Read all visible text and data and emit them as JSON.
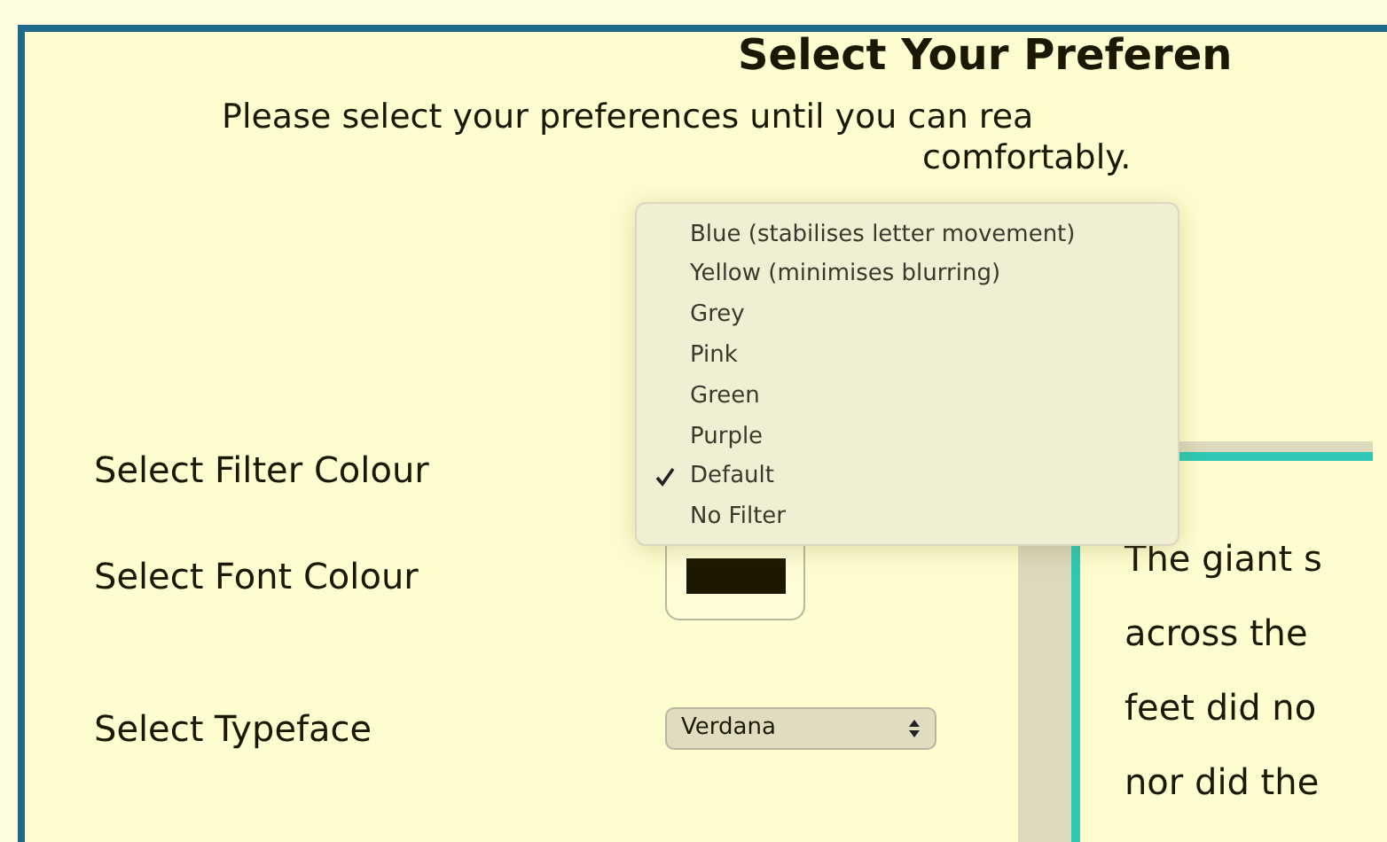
{
  "title": "Select Your Preferen",
  "intro": [
    "Please select your preferences until you can rea",
    "comfortably."
  ],
  "settings": [
    {
      "kind": "filter",
      "label": "Select Filter Colour"
    },
    {
      "kind": "swatch",
      "label": "Select Font Colour",
      "color": "#1c1800"
    },
    {
      "kind": "select",
      "label": "Select Typeface",
      "value": "Verdana"
    }
  ],
  "filter_menu": [
    {
      "label": "Blue (stabilises letter movement)",
      "selected": false
    },
    {
      "label": "Yellow (minimises blurring)",
      "selected": false
    },
    {
      "label": "Grey",
      "selected": false
    },
    {
      "label": "Pink",
      "selected": false
    },
    {
      "label": "Green",
      "selected": false
    },
    {
      "label": "Purple",
      "selected": false
    },
    {
      "label": "Default",
      "selected": true
    },
    {
      "label": "No Filter",
      "selected": false
    }
  ],
  "sample_text": [
    "The giant s",
    "across the",
    "feet did no",
    "nor did the"
  ]
}
